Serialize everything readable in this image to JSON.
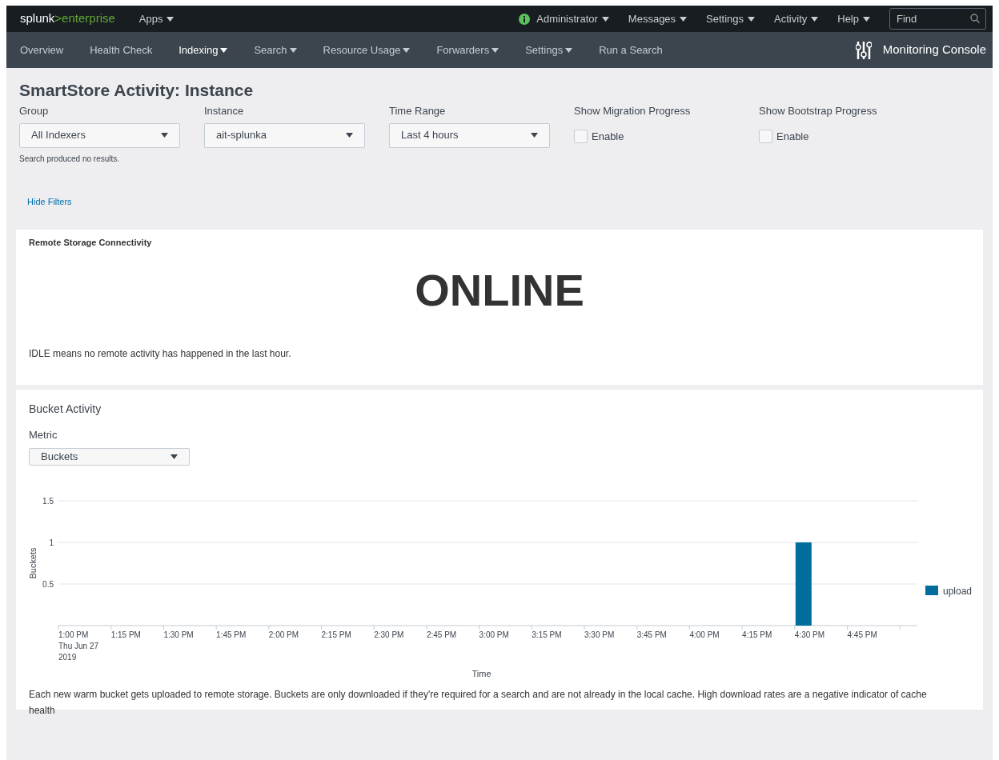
{
  "top_bar": {
    "logo": {
      "main": "splunk",
      "accent": ">enterprise"
    },
    "apps_menu": "Apps",
    "user_menus": [
      "Administrator",
      "Messages",
      "Settings",
      "Activity",
      "Help"
    ],
    "search": {
      "placeholder": "Find"
    }
  },
  "nav": {
    "items": [
      {
        "label": "Overview",
        "dropdown": false,
        "selected": false
      },
      {
        "label": "Health Check",
        "dropdown": false,
        "selected": false
      },
      {
        "label": "Indexing",
        "dropdown": true,
        "selected": true
      },
      {
        "label": "Search",
        "dropdown": true,
        "selected": false
      },
      {
        "label": "Resource Usage",
        "dropdown": true,
        "selected": false
      },
      {
        "label": "Forwarders",
        "dropdown": true,
        "selected": false
      },
      {
        "label": "Settings",
        "dropdown": true,
        "selected": false
      },
      {
        "label": "Run a Search",
        "dropdown": false,
        "selected": false
      }
    ],
    "app_title": "Monitoring Console"
  },
  "page_title": "SmartStore Activity: Instance",
  "filters": [
    {
      "kind": "dropdown",
      "label": "Group",
      "value": "All Indexers",
      "note": "Search produced no results."
    },
    {
      "kind": "dropdown",
      "label": "Instance",
      "value": "ait-splunka"
    },
    {
      "kind": "dropdown",
      "label": "Time Range",
      "value": "Last 4 hours"
    },
    {
      "kind": "checkbox",
      "label": "Show Migration Progress",
      "option": "Enable",
      "checked": false
    },
    {
      "kind": "checkbox",
      "label": "Show Bootstrap Progress",
      "option": "Enable",
      "checked": false
    }
  ],
  "hide_filters": "Hide Filters",
  "connectivity_panel": {
    "title": "Remote Storage Connectivity",
    "status": "ONLINE",
    "description": "IDLE means no remote activity has happened in the last hour."
  },
  "bucket_panel": {
    "title": "Bucket Activity",
    "metric": {
      "label": "Metric",
      "value": "Buckets"
    },
    "chart_data": {
      "type": "bar",
      "xlabel": "Time",
      "ylabel": "Buckets",
      "categories": [
        "1:00 PM\nThu Jun 27\n2019",
        "1:15 PM",
        "1:30 PM",
        "1:45 PM",
        "2:00 PM",
        "2:15 PM",
        "2:30 PM",
        "2:45 PM",
        "3:00 PM",
        "3:15 PM",
        "3:30 PM",
        "3:45 PM",
        "4:00 PM",
        "4:15 PM",
        "4:30 PM",
        "4:45 PM"
      ],
      "series": [
        {
          "name": "upload",
          "color": "#006d9c",
          "values": [
            0,
            0,
            0,
            0,
            0,
            0,
            0,
            0,
            0,
            0,
            0,
            0,
            0,
            0,
            1,
            0
          ]
        }
      ],
      "ylim": [
        0,
        1.5
      ],
      "yticks": [
        0.5,
        1,
        1.5
      ]
    },
    "description": "Each new warm bucket gets uploaded to remote storage. Buckets are only downloaded if they're required for a search and are not already in the local cache. High download rates are a negative indicator of cache health"
  }
}
